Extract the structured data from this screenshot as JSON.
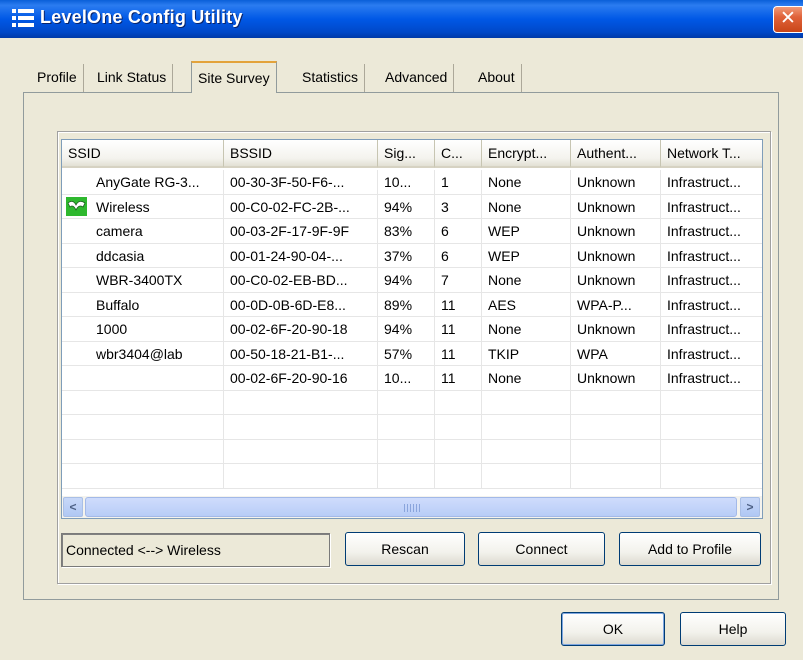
{
  "window": {
    "title": "LevelOne Config Utility",
    "close_glyph": "✕"
  },
  "tabs": [
    {
      "label": "Profile"
    },
    {
      "label": "Link Status"
    },
    {
      "label": "Site Survey"
    },
    {
      "label": "Statistics"
    },
    {
      "label": "Advanced"
    },
    {
      "label": "About"
    }
  ],
  "active_tab": "Site Survey",
  "table": {
    "columns": [
      "SSID",
      "BSSID",
      "Sig...",
      "C...",
      "Encrypt...",
      "Authent...",
      "Network T..."
    ],
    "rows": [
      [
        "AnyGate RG-3...",
        "00-30-3F-50-F6-...",
        "10...",
        "1",
        "None",
        "Unknown",
        "Infrastruct..."
      ],
      [
        "Wireless",
        "00-C0-02-FC-2B-...",
        "94%",
        "3",
        "None",
        "Unknown",
        "Infrastruct..."
      ],
      [
        "camera",
        "00-03-2F-17-9F-9F",
        "83%",
        "6",
        "WEP",
        "Unknown",
        "Infrastruct..."
      ],
      [
        "ddcasia",
        "00-01-24-90-04-...",
        "37%",
        "6",
        "WEP",
        "Unknown",
        "Infrastruct..."
      ],
      [
        "WBR-3400TX",
        "00-C0-02-EB-BD...",
        "94%",
        "7",
        "None",
        "Unknown",
        "Infrastruct..."
      ],
      [
        "Buffalo",
        "00-0D-0B-6D-E8...",
        "89%",
        "11",
        "AES",
        "WPA-P...",
        "Infrastruct..."
      ],
      [
        "1000",
        "00-02-6F-20-90-18",
        "94%",
        "11",
        "None",
        "Unknown",
        "Infrastruct..."
      ],
      [
        "wbr3404@lab",
        "00-50-18-21-B1-...",
        "57%",
        "11",
        "TKIP",
        "WPA",
        "Infrastruct..."
      ],
      [
        "",
        "00-02-6F-20-90-16",
        "10...",
        "11",
        "None",
        "Unknown",
        "Infrastruct..."
      ],
      [
        "",
        "",
        "",
        "",
        "",
        "",
        ""
      ],
      [
        "",
        "",
        "",
        "",
        "",
        "",
        ""
      ],
      [
        "",
        "",
        "",
        "",
        "",
        "",
        ""
      ],
      [
        "",
        "",
        "",
        "",
        "",
        "",
        ""
      ]
    ],
    "connected_row_index": 1
  },
  "scrollbar": {
    "left_glyph": "<",
    "right_glyph": ">"
  },
  "status": {
    "text": "Connected <--> Wireless"
  },
  "buttons": {
    "rescan": "Rescan",
    "connect": "Connect",
    "add_to_profile": "Add to Profile",
    "ok": "OK",
    "help": "Help"
  },
  "colors": {
    "titlebar": "#0058e6",
    "close_button": "#e0623a",
    "active_tab_accent": "#e3a33b",
    "connected_icon": "#2eb82e"
  }
}
